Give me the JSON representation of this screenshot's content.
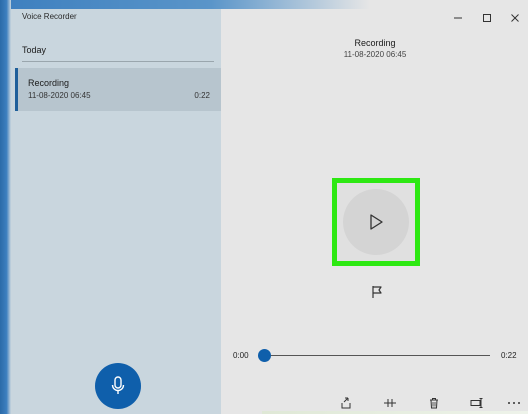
{
  "window": {
    "title": "Voice Recorder"
  },
  "sidebar": {
    "group_header": "Today",
    "items": [
      {
        "title": "Recording",
        "date": "11-08-2020 06:45",
        "duration": "0:22"
      }
    ]
  },
  "main": {
    "title": "Recording",
    "date": "11-08-2020 06:45",
    "time_start": "0:00",
    "time_end": "0:22",
    "playback_progress": 0
  },
  "colors": {
    "accent": "#0f5fab",
    "highlight": "#2de812"
  },
  "icons": {
    "mic": "microphone-icon",
    "play": "play-icon",
    "flag": "flag-icon",
    "share": "share-icon",
    "trim": "trim-icon",
    "delete": "delete-icon",
    "rename": "rename-icon",
    "more": "more-icon"
  }
}
